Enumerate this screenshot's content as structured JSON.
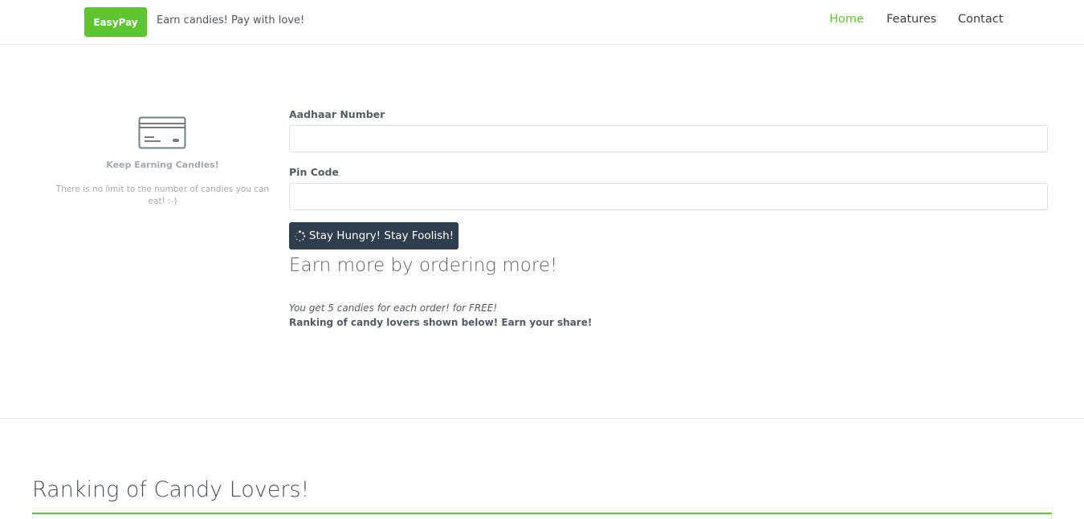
{
  "header": {
    "brand": "EasyPay",
    "tagline": "Earn candies! Pay with love!",
    "nav": [
      {
        "label": "Home",
        "active": true
      },
      {
        "label": "Features",
        "active": false
      },
      {
        "label": "Contact",
        "active": false
      }
    ]
  },
  "feature": {
    "icon": "credit-card-icon",
    "title": "Keep Earning Candies!",
    "text": "There is no limit to the number of candies you can eat! :-)"
  },
  "form": {
    "aadhaar_label": "Aadhaar Number",
    "aadhaar_value": "",
    "pin_label": "Pin Code",
    "pin_value": "",
    "submit_label": "Stay Hungry! Stay Foolish!",
    "submit_icon": "spinner-icon"
  },
  "promo": {
    "heading": "Earn more by ordering more!",
    "note": "You get 5 candies for each order! for FREE!",
    "strong": "Ranking of candy lovers shown below! Earn your share!"
  },
  "ranking": {
    "heading": "Ranking of Candy Lovers!"
  },
  "colors": {
    "accent": "#5ec431",
    "button": "#2f3e4e",
    "muted_text": "#a4a9ad"
  }
}
